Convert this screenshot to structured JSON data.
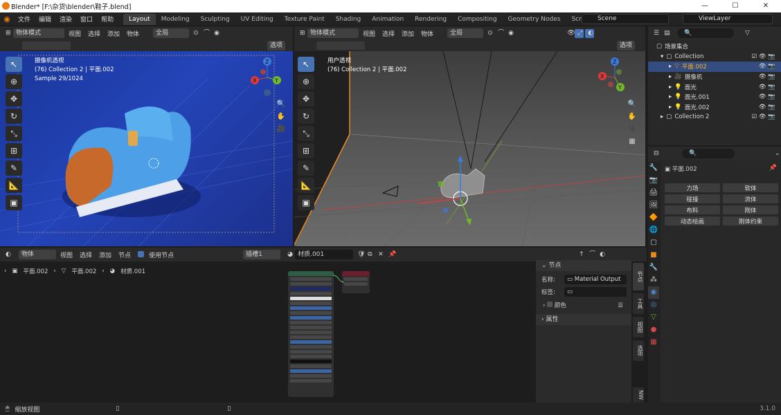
{
  "window": {
    "title": "Blender* [F:\\杂货\\blender\\鞋子.blend]",
    "controls": [
      "—",
      "☐",
      "✕"
    ]
  },
  "menu": [
    "文件",
    "编辑",
    "渲染",
    "窗口",
    "帮助"
  ],
  "workspaces": [
    "Layout",
    "Modeling",
    "Sculpting",
    "UV Editing",
    "Texture Paint",
    "Shading",
    "Animation",
    "Rendering",
    "Compositing",
    "Geometry Nodes",
    "Scripting"
  ],
  "active_workspace": "Layout",
  "scene": "Scene",
  "view_layer": "ViewLayer",
  "vp_left": {
    "mode": "物体模式",
    "menus": [
      "视图",
      "选择",
      "添加",
      "物体"
    ],
    "transform": "全局",
    "options": "选项",
    "title": "摄像机透视",
    "collection": "(76) Collection 2 | 平面.002",
    "sample": "Sample 29/1024"
  },
  "vp_right": {
    "mode": "物体模式",
    "menus": [
      "视图",
      "选择",
      "添加",
      "物体"
    ],
    "transform": "全局",
    "options": "选项",
    "title": "用户透视",
    "collection": "(76) Collection 2 | 平面.002"
  },
  "gizmo": {
    "x": "X",
    "y": "Y",
    "z": "Z"
  },
  "outliner": {
    "search": "",
    "root": "场景集合",
    "items": [
      {
        "label": "Collection",
        "indent": 1
      },
      {
        "label": "平面.002",
        "indent": 2
      },
      {
        "label": "摄像机",
        "indent": 2
      },
      {
        "label": "面光",
        "indent": 2
      },
      {
        "label": "面光.001",
        "indent": 2
      },
      {
        "label": "面光.002",
        "indent": 2
      },
      {
        "label": "Collection 2",
        "indent": 1
      }
    ]
  },
  "properties": {
    "object": "平面.002",
    "buttons": [
      "力场",
      "软体",
      "碰撞",
      "流体",
      "布料",
      "刚体",
      "动态绘画",
      "刚体约束"
    ]
  },
  "node_editor": {
    "mode": "物体",
    "menus": [
      "视图",
      "选择",
      "添加",
      "节点"
    ],
    "use_nodes": "使用节点",
    "slot": "插槽1",
    "material": "材质.001",
    "breadcrumb": [
      "平面.002",
      "平面.002",
      "材质.001"
    ]
  },
  "node_panel": {
    "section": "节点",
    "name_label": "名称:",
    "name_value": "Material Output",
    "label_label": "标签:",
    "color": "颜色",
    "properties": "属性"
  },
  "side_tabs": [
    "节点",
    "工具",
    "视图",
    "选项",
    "NW"
  ],
  "statusbar": {
    "left": "缩放视图",
    "version": "3.1.0"
  }
}
